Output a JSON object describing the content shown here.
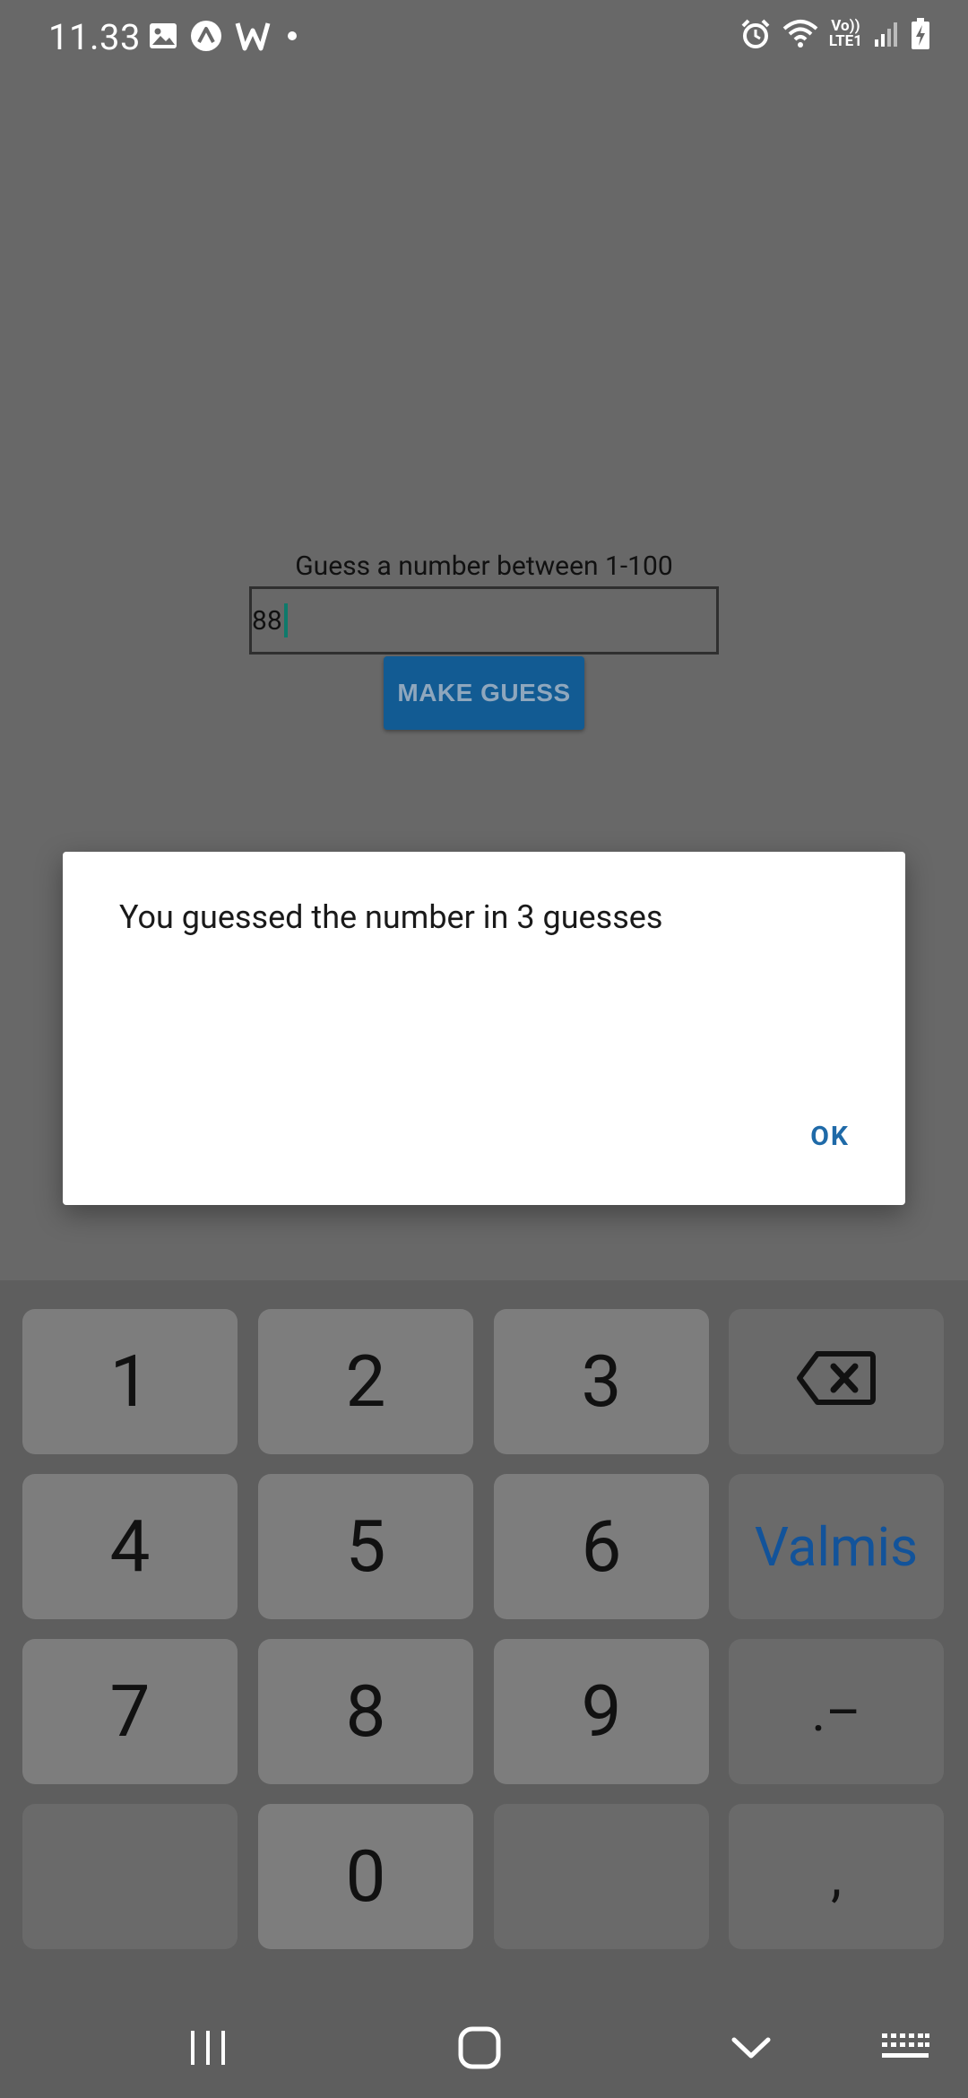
{
  "status_bar": {
    "time": "11.33",
    "volte_line1": "Vo))",
    "volte_line2": "LTE1",
    "left_icons": [
      "image-icon",
      "app-logo-icon",
      "w-app-icon",
      "dot-icon"
    ],
    "right_icons": [
      "alarm-icon",
      "wifi-icon",
      "volte-indicator",
      "signal-icon",
      "battery-charging-icon"
    ]
  },
  "app": {
    "prompt": "Guess a number between 1-100",
    "input_value": "88",
    "make_guess_label": "MAKE GUESS"
  },
  "dialog": {
    "message": "You guessed the number in 3 guesses",
    "ok_label": "OK"
  },
  "keyboard": {
    "keys": {
      "k1": "1",
      "k2": "2",
      "k3": "3",
      "k4": "4",
      "k5": "5",
      "k6": "6",
      "k7": "7",
      "k8": "8",
      "k9": "9",
      "k0": "0",
      "done": "Valmis",
      "dot_dash": ".–",
      "comma": ","
    },
    "icons": [
      "backspace-icon"
    ]
  },
  "nav_bar": {
    "icons": [
      "recent-apps-icon",
      "home-icon",
      "hide-keyboard-icon",
      "keyboard-switch-icon"
    ]
  },
  "colors": {
    "scrim_background": "#686868",
    "button": "#125b93",
    "accent_ok": "#1f6aa8",
    "done_key_text": "#12539a",
    "cursor": "#0e7a6b"
  }
}
